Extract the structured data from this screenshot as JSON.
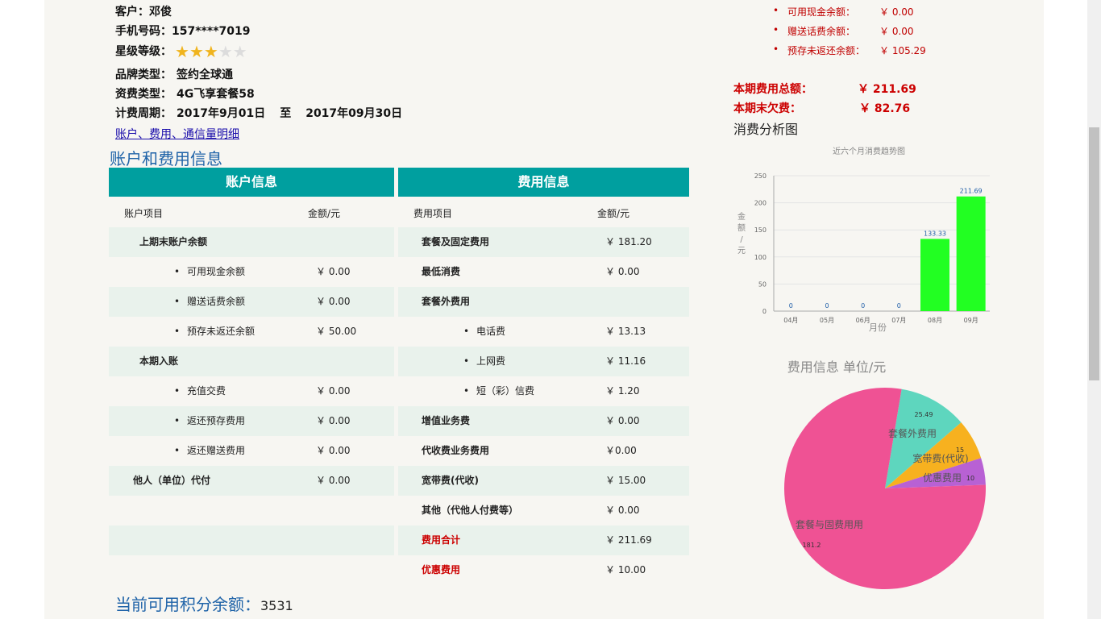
{
  "customer": {
    "name_label": "客户：",
    "name": "邓俊",
    "phone_label": "手机号码：",
    "phone": "157****7019",
    "star_label": "星级等级：",
    "stars": 3,
    "stars_max": 5,
    "brand_label": "品牌类型：",
    "brand": "签约全球通",
    "plan_label": "资费类型：",
    "plan": "4G飞享套餐58",
    "period_label": "计费周期：",
    "period_start": "2017年9月01日",
    "period_to": "至",
    "period_end": "2017年09月30日",
    "detail_link": "账户、费用、通信量明细"
  },
  "section_title": "账户和费用信息",
  "account": {
    "header": "账户信息",
    "col_item": "账户项目",
    "col_amount": "金额/元",
    "rows": [
      {
        "label": "上期末账户余额",
        "value": ""
      },
      {
        "label": "可用现金余额",
        "value": "￥ 0.00"
      },
      {
        "label": "赠送话费余额",
        "value": "￥ 0.00"
      },
      {
        "label": "预存未返还余额",
        "value": "￥ 50.00"
      },
      {
        "label": "本期入账",
        "value": ""
      },
      {
        "label": "充值交费",
        "value": "￥ 0.00"
      },
      {
        "label": "返还预存费用",
        "value": "￥ 0.00"
      },
      {
        "label": "返还赠送费用",
        "value": "￥ 0.00"
      },
      {
        "label": "他人（单位）代付",
        "value": "￥ 0.00"
      }
    ]
  },
  "fees": {
    "header": "费用信息",
    "col_item": "费用项目",
    "col_amount": "金额/元",
    "rows": [
      {
        "label": "套餐及固定费用",
        "value": "￥ 181.20"
      },
      {
        "label": "最低消费",
        "value": "￥ 0.00"
      },
      {
        "label": "套餐外费用",
        "value": ""
      },
      {
        "label": "电话费",
        "value": "￥ 13.13"
      },
      {
        "label": "上网费",
        "value": "￥ 11.16"
      },
      {
        "label": "短（彩）信费",
        "value": "￥ 1.20"
      },
      {
        "label": "增值业务费",
        "value": "￥ 0.00"
      },
      {
        "label": "代收费业务费用",
        "value": "￥0.00"
      },
      {
        "label": "宽带费(代收)",
        "value": "￥ 15.00"
      },
      {
        "label": "其他（代他人付费等）",
        "value": "￥ 0.00"
      },
      {
        "label": "费用合计",
        "value": "￥ 211.69"
      },
      {
        "label": "优惠费用",
        "value": "￥ 10.00"
      }
    ]
  },
  "balances": [
    {
      "label": "可用现金余额：",
      "value": "￥ 0.00"
    },
    {
      "label": "赠送话费余额：",
      "value": "￥ 0.00"
    },
    {
      "label": "预存未返还余额：",
      "value": "￥ 105.29"
    }
  ],
  "totals": [
    {
      "label": "本期费用总额：",
      "value": "￥ 211.69"
    },
    {
      "label": "本期末欠费：",
      "value": "￥ 82.76"
    }
  ],
  "analysis_title": "消费分析图",
  "points": {
    "label": "当前可用积分余额：",
    "value": "3531"
  },
  "colors": {
    "teal": "#009f9f",
    "red": "#cc0000",
    "blue_title": "#1f63a8",
    "bar": "#22ff22",
    "star": "#f0b41e"
  },
  "chart_data": [
    {
      "type": "bar",
      "title": "近六个月消费趋势图",
      "xlabel": "月份",
      "ylabel": "金额/元",
      "categories": [
        "04月",
        "05月",
        "06月",
        "07月",
        "08月",
        "09月"
      ],
      "values": [
        0,
        0,
        0,
        0,
        133.33,
        211.69
      ],
      "data_labels": [
        "0",
        "0",
        "0",
        "0",
        "133.33",
        "211.69"
      ],
      "ylim": [
        0,
        250
      ],
      "yticks": [
        "0",
        "50",
        "100",
        "150",
        "200",
        "250"
      ],
      "grid": true
    },
    {
      "type": "pie",
      "title": "费用信息 单位/元",
      "slices": [
        {
          "name": "套餐外费用",
          "value": 25.49,
          "value_label": "25.49",
          "color": "#5ed6be"
        },
        {
          "name": "宽带费(代收)",
          "value": 15,
          "value_label": "15",
          "color": "#f7b11f"
        },
        {
          "name": "优惠费用",
          "value": 10,
          "value_label": "10",
          "color": "#b861d4"
        },
        {
          "name": "套餐与固费用用",
          "value": 181.2,
          "value_label": "181.2",
          "color": "#ef5294"
        }
      ]
    }
  ]
}
